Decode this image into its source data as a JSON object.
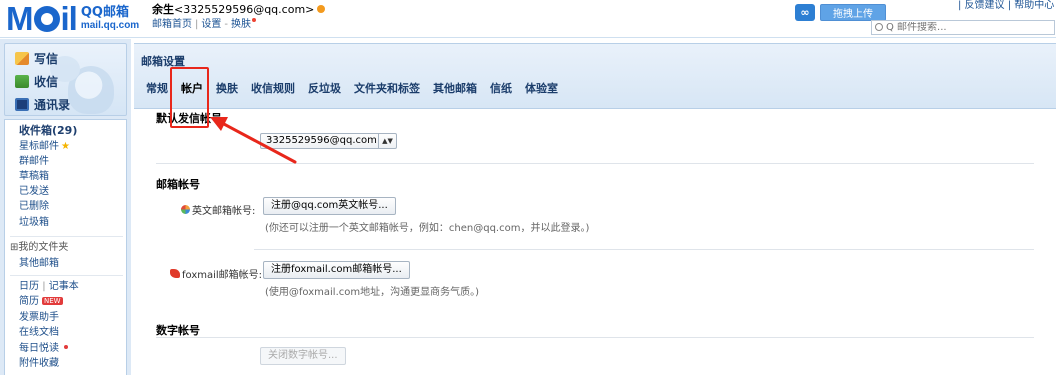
{
  "header": {
    "logo_text": "Mail",
    "logo_cn": "QQ邮箱",
    "logo_en": "mail.qq.com",
    "user_name": "余生",
    "user_email": "<3325529596@qq.com>",
    "link_home": "邮箱首页",
    "link_settings": "设置",
    "link_skin": "换肤",
    "separator": "|",
    "upload_label": "拖拽上传",
    "top_links": "| 反馈建议 | 帮助中心 |",
    "search_placeholder": "Q 邮件搜索..."
  },
  "sidebar": {
    "compose": "写信",
    "receive": "收信",
    "contacts": "通讯录",
    "folders": [
      {
        "label": "收件箱(29)"
      },
      {
        "label": "星标邮件"
      },
      {
        "label": "群邮件"
      },
      {
        "label": "草稿箱"
      },
      {
        "label": "已发送"
      },
      {
        "label": "已删除"
      },
      {
        "label": "垃圾箱"
      }
    ],
    "my_folders": "我的文件夹",
    "other_mailbox": "其他邮箱",
    "calendar": "日历",
    "notes": "记事本",
    "calendar_sep": "|",
    "resume": "简历",
    "new_badge": "NEW",
    "invoice": "发票助手",
    "online_docs": "在线文档",
    "daily_read": "每日悦读",
    "attachments": "附件收藏"
  },
  "settings": {
    "title": "邮箱设置",
    "tabs": [
      "常规",
      "帐户",
      "换肤",
      "收信规则",
      "反垃圾",
      "文件夹和标签",
      "其他邮箱",
      "信纸",
      "体验室"
    ],
    "active_tab": "帐户",
    "default_sender_title": "默认发信帐号",
    "default_sender_value": "3325529596@qq.com",
    "mailbox_account_title": "邮箱帐号",
    "english_label": "英文邮箱帐号:",
    "english_button": "注册@qq.com英文帐号...",
    "english_hint": "(你还可以注册一个英文邮箱帐号，例如：chen@qq.com，并以此登录。)",
    "foxmail_label": "foxmail邮箱帐号:",
    "foxmail_button": "注册foxmail.com邮箱帐号...",
    "foxmail_hint": "(使用@foxmail.com地址，沟通更显商务气质。)",
    "digital_title": "数字帐号",
    "digital_button": "关闭数字帐号..."
  },
  "colors": {
    "accent": "#1a66cc",
    "annotation": "#e8271b",
    "sidebar_bg": "#dde9f6"
  }
}
